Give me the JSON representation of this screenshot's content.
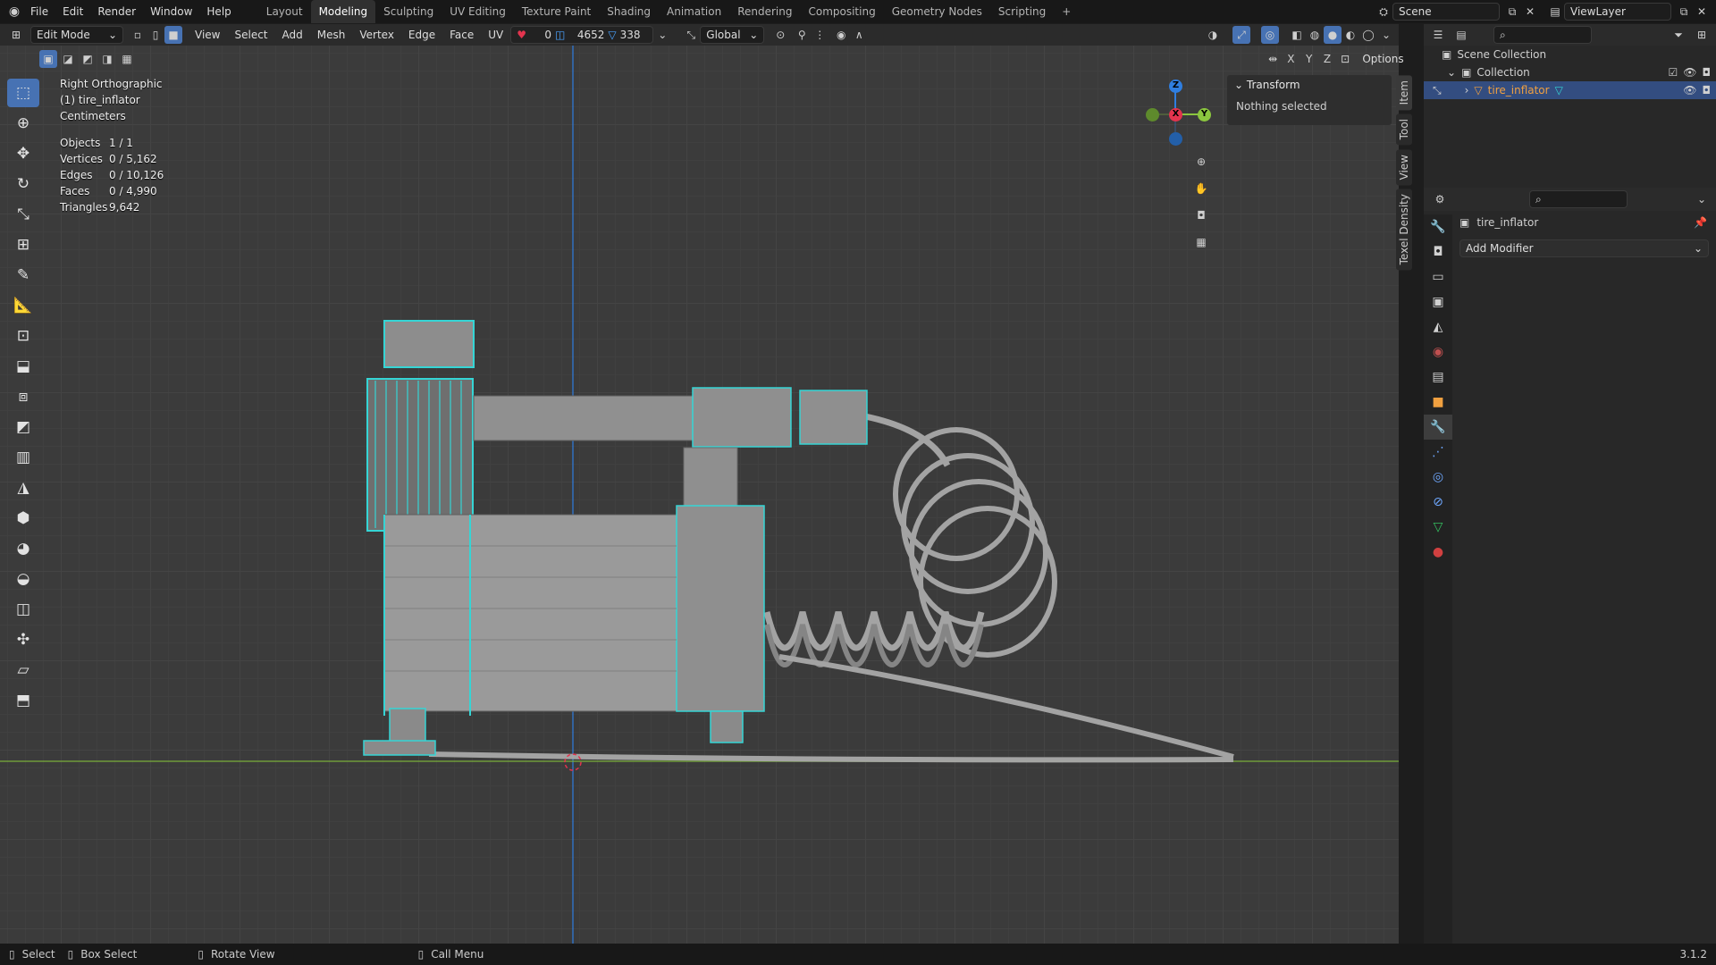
{
  "app": {
    "menus": [
      "File",
      "Edit",
      "Render",
      "Window",
      "Help"
    ],
    "workspaces": [
      "Layout",
      "Modeling",
      "Sculpting",
      "UV Editing",
      "Texture Paint",
      "Shading",
      "Animation",
      "Rendering",
      "Compositing",
      "Geometry Nodes",
      "Scripting"
    ],
    "active_workspace": "Modeling",
    "scene": "Scene",
    "view_layer": "ViewLayer",
    "version": "3.1.2"
  },
  "header": {
    "mode": "Edit Mode",
    "menus": [
      "View",
      "Select",
      "Add",
      "Mesh",
      "Vertex",
      "Edge",
      "Face",
      "UV"
    ],
    "uv_seam_count": "0",
    "edge_count": "4652",
    "vertex_count": "338",
    "orientation": "Global",
    "axis_x": "X",
    "axis_y": "Y",
    "axis_z": "Z",
    "options": "Options"
  },
  "viewport": {
    "view_name": "Right Orthographic",
    "object_label": "(1) tire_inflator",
    "units": "Centimeters",
    "stats": [
      {
        "label": "Objects",
        "value": "1 / 1"
      },
      {
        "label": "Vertices",
        "value": "0 / 5,162"
      },
      {
        "label": "Edges",
        "value": "0 / 10,126"
      },
      {
        "label": "Faces",
        "value": "0 / 4,990"
      },
      {
        "label": "Triangles",
        "value": "9,642"
      }
    ],
    "gizmo": {
      "x": "X",
      "y": "Y",
      "z": "Z"
    }
  },
  "npanel": {
    "section": "Transform",
    "message": "Nothing selected",
    "tabs": [
      "Item",
      "Tool",
      "View",
      "Texel Density"
    ]
  },
  "outliner": {
    "root": "Scene Collection",
    "collection": "Collection",
    "object": "tire_inflator"
  },
  "properties": {
    "object_name": "tire_inflator",
    "add_modifier": "Add Modifier"
  },
  "status": {
    "select": "Select",
    "box_select": "Box Select",
    "rotate_view": "Rotate View",
    "call_menu": "Call Menu"
  },
  "colors": {
    "accent": "#4772b3",
    "wire_selected": "#35d5d5",
    "axis_x": "#e3344e",
    "axis_y": "#8bc63f",
    "axis_z": "#2f7ee0"
  }
}
